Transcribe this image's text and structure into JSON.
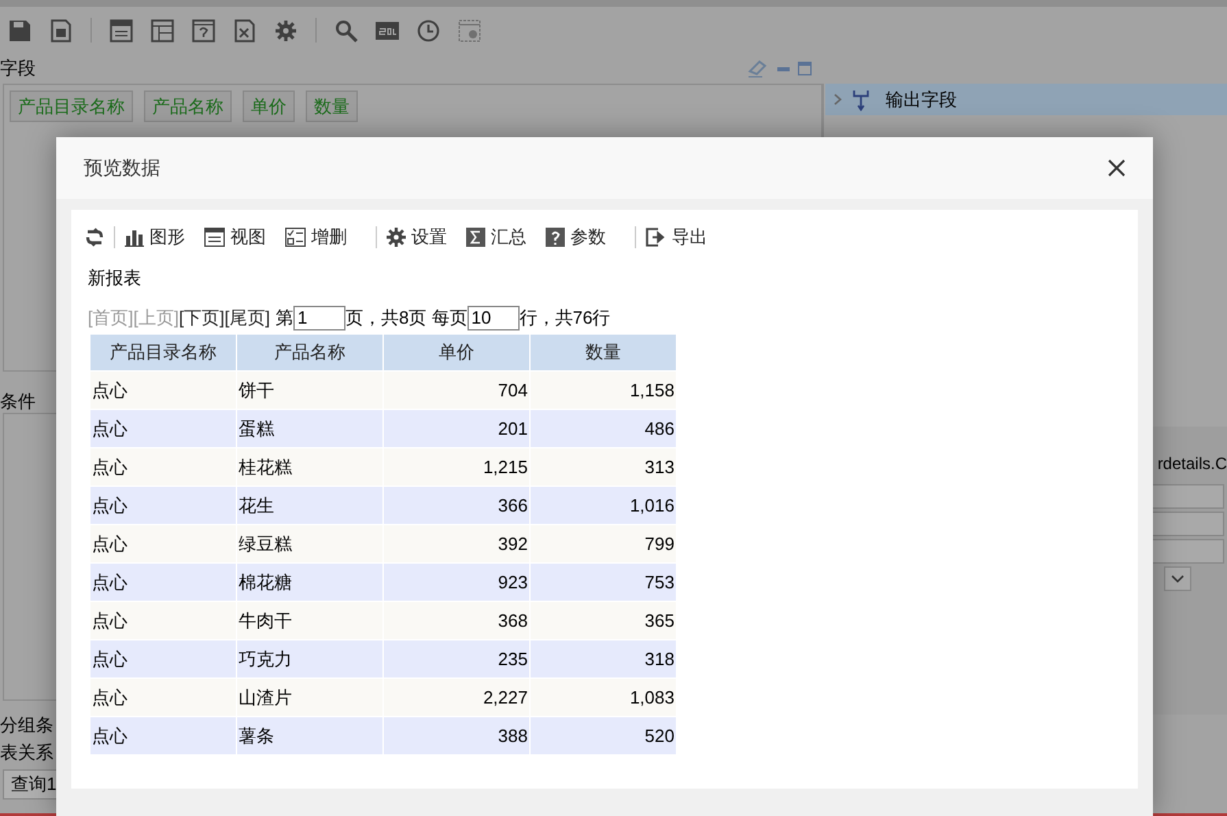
{
  "app": {
    "fields_label": "字段",
    "field_chips": [
      "产品目录名称",
      "产品名称",
      "单价",
      "数量"
    ],
    "tree": [
      {
        "label": "输出字段",
        "selected": true
      }
    ],
    "conditions_label": "条件",
    "group_label": "分组条",
    "relation_label": "表关系",
    "query_tab": "查询1",
    "right_text": "rdetails.C"
  },
  "dialog": {
    "title": "预览数据",
    "toolbar": [
      {
        "kind": "refresh"
      },
      {
        "kind": "chart",
        "label": "图形"
      },
      {
        "kind": "view",
        "label": "视图"
      },
      {
        "kind": "edit",
        "label": "增删"
      },
      {
        "kind": "settings",
        "label": "设置"
      },
      {
        "kind": "sum",
        "label": "汇总"
      },
      {
        "kind": "help",
        "label": "参数"
      },
      {
        "kind": "export",
        "label": "导出"
      }
    ],
    "report_title": "新报表",
    "pager": {
      "links": [
        {
          "label": "[首页]",
          "disabled": true
        },
        {
          "label": "[上页]",
          "disabled": true
        },
        {
          "label": "[下页]",
          "disabled": false
        },
        {
          "label": "[尾页]",
          "disabled": false
        }
      ],
      "page_prefix": "第",
      "page_value": "1",
      "page_suffix": "页，共8页 每页",
      "rows_value": "10",
      "rows_suffix": "行，共76行"
    },
    "table": {
      "columns": [
        "产品目录名称",
        "产品名称",
        "单价",
        "数量"
      ],
      "rows": [
        [
          "点心",
          "饼干",
          "704",
          "1,158"
        ],
        [
          "点心",
          "蛋糕",
          "201",
          "486"
        ],
        [
          "点心",
          "桂花糕",
          "1,215",
          "313"
        ],
        [
          "点心",
          "花生",
          "366",
          "1,016"
        ],
        [
          "点心",
          "绿豆糕",
          "392",
          "799"
        ],
        [
          "点心",
          "棉花糖",
          "923",
          "753"
        ],
        [
          "点心",
          "牛肉干",
          "368",
          "365"
        ],
        [
          "点心",
          "巧克力",
          "235",
          "318"
        ],
        [
          "点心",
          "山渣片",
          "2,227",
          "1,083"
        ],
        [
          "点心",
          "薯条",
          "388",
          "520"
        ]
      ]
    }
  }
}
